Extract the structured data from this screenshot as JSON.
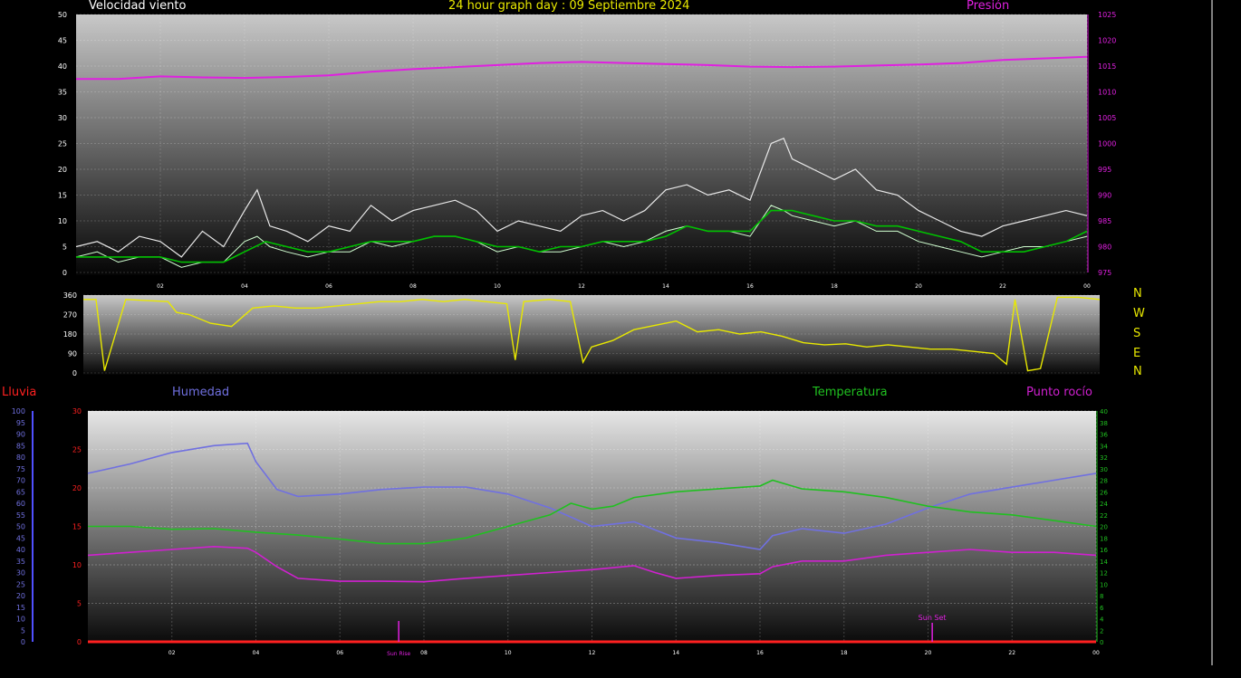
{
  "title": "24 hour graph day : 09 Septiembre 2024",
  "colors": {
    "background": "#000000",
    "title": "#e8e800",
    "wind": "#ffffff",
    "wind_avg": "#00c000",
    "pressure": "#e020e0",
    "direction": "#e8e800",
    "humidity": "#7070e0",
    "temperature": "#20c020",
    "dewpoint": "#d020d0",
    "rain": "#ff2020",
    "rain_axis": "#5050ff"
  },
  "legend": {
    "wind": "Velocidad viento",
    "pressure": "Presión",
    "rain": "Lluvia",
    "humidity": "Humedad",
    "temperature": "Temperatura",
    "dewpoint": "Punto rocío"
  },
  "compass": [
    "N",
    "W",
    "S",
    "E",
    "N"
  ],
  "sun_events": {
    "sunrise": {
      "label": "Sun Rise",
      "hour": 7.4
    },
    "sunset": {
      "label": "Sun Set",
      "hour": 20.1
    }
  },
  "chart_data": [
    {
      "type": "line",
      "name": "wind-pressure",
      "x_ticks": [
        "02",
        "04",
        "06",
        "08",
        "10",
        "12",
        "14",
        "16",
        "18",
        "20",
        "22",
        "00"
      ],
      "y_left": {
        "ticks": [
          0,
          5,
          10,
          15,
          20,
          25,
          30,
          35,
          40,
          45,
          50
        ],
        "range": [
          0,
          50
        ]
      },
      "y_right": {
        "ticks": [
          975,
          980,
          985,
          990,
          995,
          1000,
          1005,
          1010,
          1015,
          1020,
          1025
        ],
        "range": [
          975,
          1025
        ]
      },
      "wind_gust": [
        [
          0,
          5
        ],
        [
          0.5,
          6
        ],
        [
          1,
          4
        ],
        [
          1.5,
          7
        ],
        [
          2,
          6
        ],
        [
          2.5,
          3
        ],
        [
          3,
          8
        ],
        [
          3.5,
          5
        ],
        [
          4,
          12
        ],
        [
          4.3,
          16
        ],
        [
          4.6,
          9
        ],
        [
          5,
          8
        ],
        [
          5.5,
          6
        ],
        [
          6,
          9
        ],
        [
          6.5,
          8
        ],
        [
          7,
          13
        ],
        [
          7.5,
          10
        ],
        [
          8,
          12
        ],
        [
          8.5,
          13
        ],
        [
          9,
          14
        ],
        [
          9.5,
          12
        ],
        [
          10,
          8
        ],
        [
          10.5,
          10
        ],
        [
          11,
          9
        ],
        [
          11.5,
          8
        ],
        [
          12,
          11
        ],
        [
          12.5,
          12
        ],
        [
          13,
          10
        ],
        [
          13.5,
          12
        ],
        [
          14,
          16
        ],
        [
          14.5,
          17
        ],
        [
          15,
          15
        ],
        [
          15.5,
          16
        ],
        [
          16,
          14
        ],
        [
          16.5,
          25
        ],
        [
          16.8,
          26
        ],
        [
          17,
          22
        ],
        [
          17.5,
          20
        ],
        [
          18,
          18
        ],
        [
          18.5,
          20
        ],
        [
          19,
          16
        ],
        [
          19.5,
          15
        ],
        [
          20,
          12
        ],
        [
          20.5,
          10
        ],
        [
          21,
          8
        ],
        [
          21.5,
          7
        ],
        [
          22,
          9
        ],
        [
          22.5,
          10
        ],
        [
          23,
          11
        ],
        [
          23.5,
          12
        ],
        [
          24,
          11
        ]
      ],
      "wind_speed": [
        [
          0,
          3
        ],
        [
          0.5,
          4
        ],
        [
          1,
          2
        ],
        [
          1.5,
          3
        ],
        [
          2,
          3
        ],
        [
          2.5,
          1
        ],
        [
          3,
          2
        ],
        [
          3.5,
          2
        ],
        [
          4,
          6
        ],
        [
          4.3,
          7
        ],
        [
          4.6,
          5
        ],
        [
          5,
          4
        ],
        [
          5.5,
          3
        ],
        [
          6,
          4
        ],
        [
          6.5,
          4
        ],
        [
          7,
          6
        ],
        [
          7.5,
          5
        ],
        [
          8,
          6
        ],
        [
          8.5,
          7
        ],
        [
          9,
          7
        ],
        [
          9.5,
          6
        ],
        [
          10,
          4
        ],
        [
          10.5,
          5
        ],
        [
          11,
          4
        ],
        [
          11.5,
          4
        ],
        [
          12,
          5
        ],
        [
          12.5,
          6
        ],
        [
          13,
          5
        ],
        [
          13.5,
          6
        ],
        [
          14,
          8
        ],
        [
          14.5,
          9
        ],
        [
          15,
          8
        ],
        [
          15.5,
          8
        ],
        [
          16,
          7
        ],
        [
          16.5,
          13
        ],
        [
          16.8,
          12
        ],
        [
          17,
          11
        ],
        [
          17.5,
          10
        ],
        [
          18,
          9
        ],
        [
          18.5,
          10
        ],
        [
          19,
          8
        ],
        [
          19.5,
          8
        ],
        [
          20,
          6
        ],
        [
          20.5,
          5
        ],
        [
          21,
          4
        ],
        [
          21.5,
          3
        ],
        [
          22,
          4
        ],
        [
          22.5,
          5
        ],
        [
          23,
          5
        ],
        [
          23.5,
          6
        ],
        [
          24,
          7
        ]
      ],
      "wind_avg": [
        [
          0,
          3
        ],
        [
          1,
          3
        ],
        [
          2,
          3
        ],
        [
          2.5,
          2
        ],
        [
          3,
          2
        ],
        [
          3.5,
          2
        ],
        [
          4,
          4
        ],
        [
          4.5,
          6
        ],
        [
          5,
          5
        ],
        [
          5.5,
          4
        ],
        [
          6,
          4
        ],
        [
          6.5,
          5
        ],
        [
          7,
          6
        ],
        [
          7.5,
          6
        ],
        [
          8,
          6
        ],
        [
          8.5,
          7
        ],
        [
          9,
          7
        ],
        [
          9.5,
          6
        ],
        [
          10,
          5
        ],
        [
          10.5,
          5
        ],
        [
          11,
          4
        ],
        [
          11.5,
          5
        ],
        [
          12,
          5
        ],
        [
          12.5,
          6
        ],
        [
          13,
          6
        ],
        [
          13.5,
          6
        ],
        [
          14,
          7
        ],
        [
          14.5,
          9
        ],
        [
          15,
          8
        ],
        [
          15.5,
          8
        ],
        [
          16,
          8
        ],
        [
          16.5,
          12
        ],
        [
          17,
          12
        ],
        [
          17.5,
          11
        ],
        [
          18,
          10
        ],
        [
          18.5,
          10
        ],
        [
          19,
          9
        ],
        [
          19.5,
          9
        ],
        [
          20,
          8
        ],
        [
          20.5,
          7
        ],
        [
          21,
          6
        ],
        [
          21.5,
          4
        ],
        [
          22,
          4
        ],
        [
          22.5,
          4
        ],
        [
          23,
          5
        ],
        [
          23.5,
          6
        ],
        [
          24,
          8
        ]
      ],
      "pressure": [
        [
          0,
          1012.5
        ],
        [
          1,
          1012.5
        ],
        [
          2,
          1013
        ],
        [
          3,
          1012.8
        ],
        [
          4,
          1012.7
        ],
        [
          5,
          1012.9
        ],
        [
          6,
          1013.2
        ],
        [
          7,
          1013.9
        ],
        [
          8,
          1014.4
        ],
        [
          9,
          1014.8
        ],
        [
          10,
          1015.2
        ],
        [
          11,
          1015.6
        ],
        [
          12,
          1015.8
        ],
        [
          13,
          1015.6
        ],
        [
          14,
          1015.4
        ],
        [
          15,
          1015.2
        ],
        [
          16,
          1014.9
        ],
        [
          17,
          1014.8
        ],
        [
          18,
          1014.9
        ],
        [
          19,
          1015.1
        ],
        [
          20,
          1015.3
        ],
        [
          21,
          1015.6
        ],
        [
          22,
          1016.2
        ],
        [
          23,
          1016.5
        ],
        [
          24,
          1016.8
        ]
      ]
    },
    {
      "type": "line",
      "name": "wind-direction",
      "y_left": {
        "ticks": [
          0,
          90,
          180,
          270,
          360
        ],
        "range": [
          0,
          360
        ]
      },
      "direction": [
        [
          0,
          340
        ],
        [
          0.3,
          340
        ],
        [
          0.5,
          10
        ],
        [
          1,
          340
        ],
        [
          2,
          330
        ],
        [
          2.2,
          280
        ],
        [
          2.5,
          270
        ],
        [
          3,
          230
        ],
        [
          3.5,
          215
        ],
        [
          4,
          300
        ],
        [
          4.5,
          310
        ],
        [
          5,
          300
        ],
        [
          5.5,
          300
        ],
        [
          6,
          310
        ],
        [
          6.5,
          320
        ],
        [
          7,
          330
        ],
        [
          7.5,
          330
        ],
        [
          8,
          340
        ],
        [
          8.5,
          330
        ],
        [
          9,
          340
        ],
        [
          9.5,
          330
        ],
        [
          10,
          320
        ],
        [
          10.2,
          60
        ],
        [
          10.4,
          330
        ],
        [
          11,
          340
        ],
        [
          11.5,
          330
        ],
        [
          11.8,
          50
        ],
        [
          12,
          120
        ],
        [
          12.5,
          150
        ],
        [
          13,
          200
        ],
        [
          13.5,
          220
        ],
        [
          14,
          240
        ],
        [
          14.5,
          190
        ],
        [
          15,
          200
        ],
        [
          15.5,
          180
        ],
        [
          16,
          190
        ],
        [
          16.5,
          170
        ],
        [
          17,
          140
        ],
        [
          17.5,
          130
        ],
        [
          18,
          135
        ],
        [
          18.5,
          120
        ],
        [
          19,
          130
        ],
        [
          19.5,
          120
        ],
        [
          20,
          110
        ],
        [
          20.5,
          110
        ],
        [
          21,
          100
        ],
        [
          21.5,
          90
        ],
        [
          21.8,
          40
        ],
        [
          22,
          340
        ],
        [
          22.3,
          10
        ],
        [
          22.6,
          20
        ],
        [
          23,
          350
        ],
        [
          23.5,
          350
        ],
        [
          24,
          340
        ]
      ]
    },
    {
      "type": "line",
      "name": "humidity-temperature",
      "y_left": {
        "ticks": [
          0,
          5,
          10,
          15,
          20,
          25,
          30
        ],
        "range": [
          0,
          30
        ]
      },
      "y_right": {
        "ticks": [
          0,
          2,
          4,
          6,
          8,
          10,
          12,
          14,
          16,
          18,
          20,
          22,
          24,
          26,
          28,
          30,
          32,
          34,
          36,
          38,
          40
        ],
        "range": [
          0,
          40
        ]
      },
      "y_humidity": {
        "ticks": [
          0,
          5,
          10,
          15,
          20,
          25,
          30,
          35,
          40,
          45,
          50,
          55,
          60,
          65,
          70,
          75,
          80,
          85,
          90,
          95,
          100
        ],
        "range": [
          0,
          100
        ]
      },
      "humidity": [
        [
          0,
          73
        ],
        [
          1,
          77
        ],
        [
          2,
          82
        ],
        [
          3,
          85
        ],
        [
          3.8,
          86
        ],
        [
          4,
          78
        ],
        [
          4.5,
          66
        ],
        [
          5,
          63
        ],
        [
          6,
          64
        ],
        [
          7,
          66
        ],
        [
          8,
          67
        ],
        [
          9,
          67
        ],
        [
          10,
          64
        ],
        [
          11,
          58
        ],
        [
          12,
          50
        ],
        [
          13,
          52
        ],
        [
          14,
          45
        ],
        [
          15,
          43
        ],
        [
          16,
          40
        ],
        [
          16.3,
          46
        ],
        [
          17,
          49
        ],
        [
          18,
          47
        ],
        [
          19,
          51
        ],
        [
          20,
          58
        ],
        [
          21,
          64
        ],
        [
          22,
          67
        ],
        [
          23,
          70
        ],
        [
          24,
          73
        ]
      ],
      "temperature": [
        [
          0,
          20
        ],
        [
          1,
          20
        ],
        [
          2,
          19.5
        ],
        [
          3,
          19.6
        ],
        [
          4,
          19
        ],
        [
          5,
          18.5
        ],
        [
          6,
          17.8
        ],
        [
          7,
          17
        ],
        [
          8,
          17
        ],
        [
          9,
          18
        ],
        [
          10,
          20
        ],
        [
          11,
          22
        ],
        [
          11.5,
          24
        ],
        [
          12,
          23
        ],
        [
          12.5,
          23.5
        ],
        [
          13,
          25
        ],
        [
          14,
          26
        ],
        [
          15,
          26.5
        ],
        [
          16,
          27
        ],
        [
          16.3,
          28
        ],
        [
          17,
          26.5
        ],
        [
          18,
          26
        ],
        [
          19,
          25
        ],
        [
          20,
          23.5
        ],
        [
          21,
          22.5
        ],
        [
          22,
          22
        ],
        [
          23,
          21
        ],
        [
          24,
          20
        ]
      ],
      "dewpoint": [
        [
          0,
          15
        ],
        [
          1,
          15.5
        ],
        [
          2,
          16
        ],
        [
          3,
          16.5
        ],
        [
          3.8,
          16.2
        ],
        [
          4,
          15.5
        ],
        [
          4.5,
          13
        ],
        [
          5,
          11
        ],
        [
          6,
          10.5
        ],
        [
          7,
          10.5
        ],
        [
          8,
          10.4
        ],
        [
          9,
          11
        ],
        [
          10,
          11.5
        ],
        [
          11,
          12
        ],
        [
          12,
          12.5
        ],
        [
          13,
          13.2
        ],
        [
          13.5,
          12
        ],
        [
          14,
          11
        ],
        [
          15,
          11.5
        ],
        [
          16,
          11.8
        ],
        [
          16.3,
          13
        ],
        [
          17,
          14
        ],
        [
          18,
          14
        ],
        [
          19,
          15
        ],
        [
          20,
          15.5
        ],
        [
          21,
          16
        ],
        [
          22,
          15.5
        ],
        [
          23,
          15.5
        ],
        [
          24,
          15
        ]
      ],
      "rain": [
        [
          0,
          0
        ],
        [
          24,
          0
        ]
      ]
    }
  ]
}
